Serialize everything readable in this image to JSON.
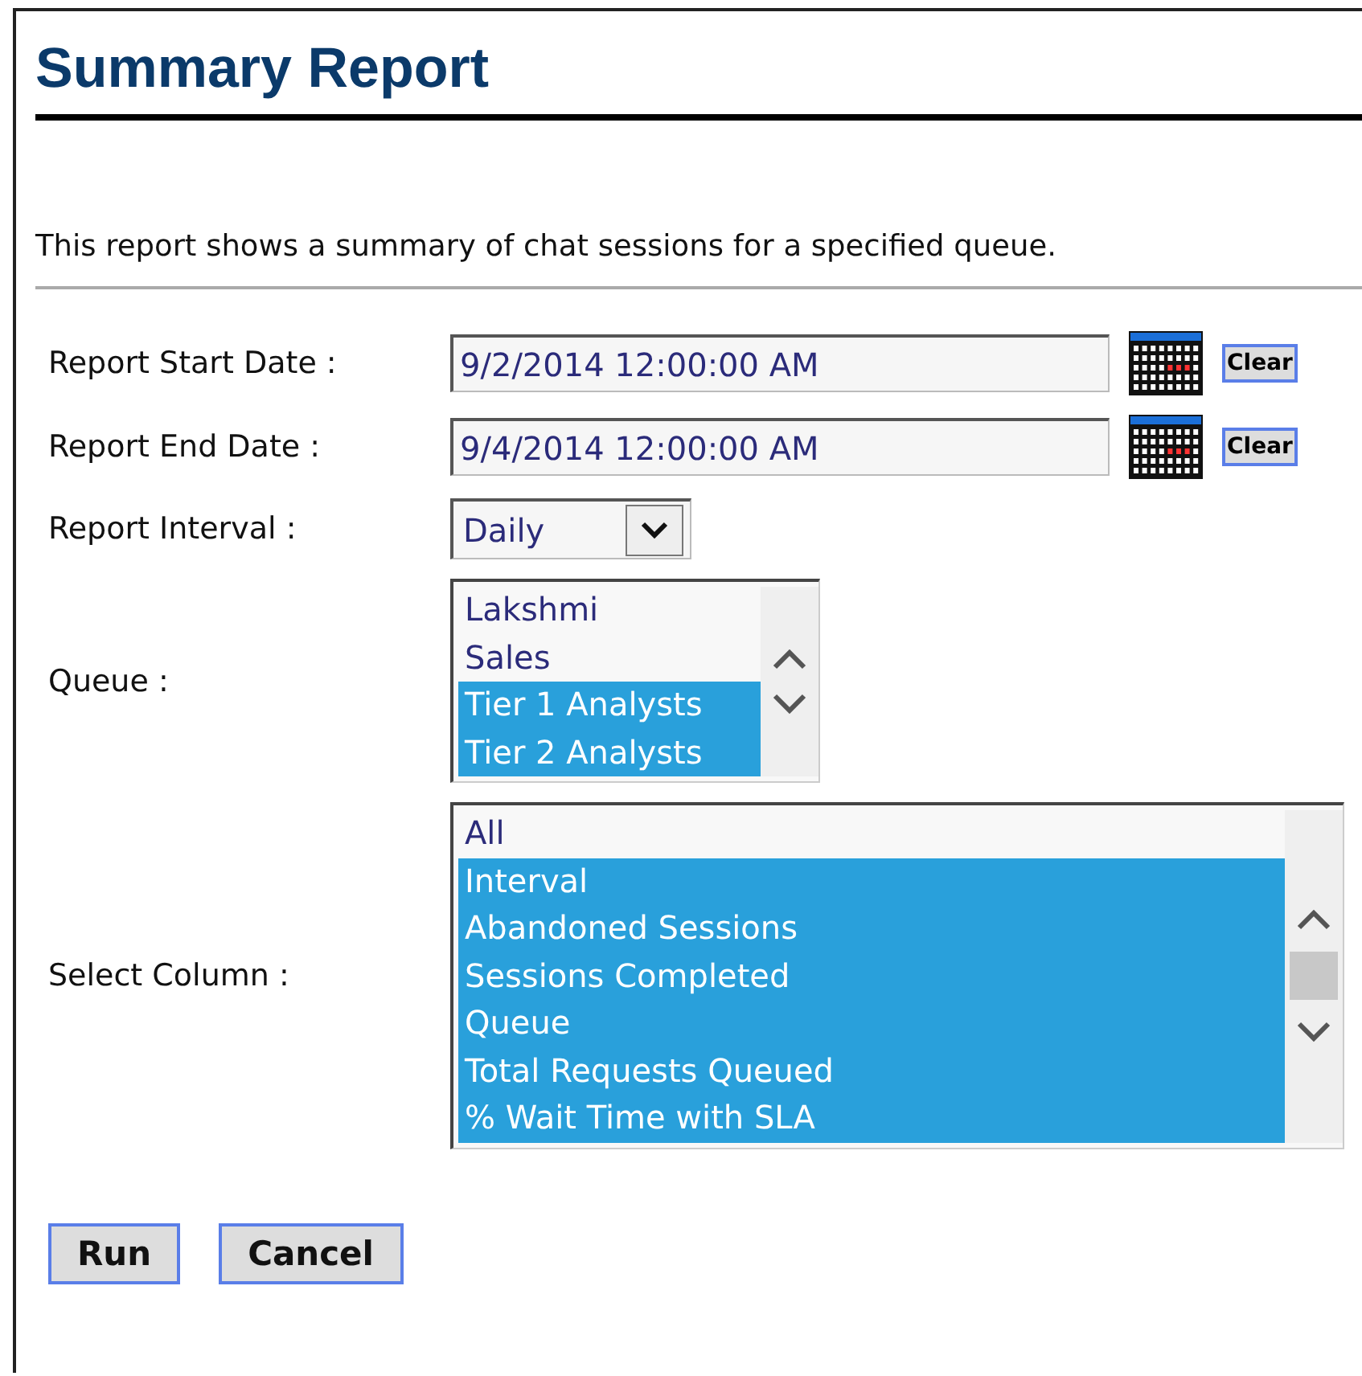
{
  "title": "Summary Report",
  "description": "This report shows a summary of chat sessions for a specified queue.",
  "start_date": {
    "label": "Report Start Date :",
    "value": "9/2/2014 12:00:00 AM",
    "clear": "Clear"
  },
  "end_date": {
    "label": "Report End Date :",
    "value": "9/4/2014 12:00:00 AM",
    "clear": "Clear"
  },
  "interval": {
    "label": "Report Interval :",
    "value": "Daily"
  },
  "queue": {
    "label": "Queue :",
    "options": [
      {
        "text": "Lakshmi",
        "selected": false
      },
      {
        "text": "Sales",
        "selected": false
      },
      {
        "text": "Tier 1 Analysts",
        "selected": true
      },
      {
        "text": "Tier 2 Analysts",
        "selected": true
      }
    ]
  },
  "columns": {
    "label": "Select Column :",
    "options": [
      {
        "text": "All",
        "selected": false
      },
      {
        "text": "Interval",
        "selected": true
      },
      {
        "text": "Abandoned Sessions",
        "selected": true
      },
      {
        "text": "Sessions Completed",
        "selected": true
      },
      {
        "text": "Queue",
        "selected": true
      },
      {
        "text": "Total Requests Queued",
        "selected": true
      },
      {
        "text": "% Wait Time with SLA",
        "selected": true
      }
    ]
  },
  "buttons": [
    "Run",
    "Cancel"
  ]
}
